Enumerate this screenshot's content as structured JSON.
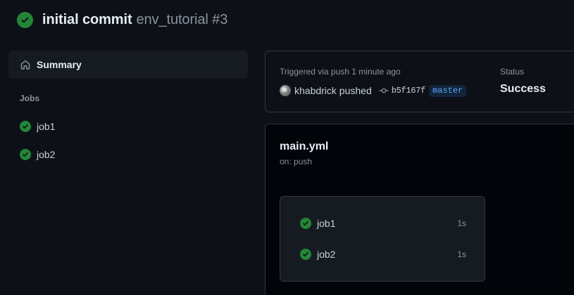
{
  "header": {
    "title": "initial commit",
    "subtitle": "env_tutorial #3",
    "status_icon": "check-circle-icon"
  },
  "sidebar": {
    "summary_label": "Summary",
    "jobs_heading": "Jobs",
    "jobs": [
      {
        "label": "job1"
      },
      {
        "label": "job2"
      }
    ]
  },
  "run": {
    "trigger_text": "Triggered via push 1 minute ago",
    "actor_text": "khabdrick pushed",
    "commit_sha": "b5f167f",
    "branch": "master",
    "status_label": "Status",
    "status_value": "Success"
  },
  "workflow": {
    "file": "main.yml",
    "trigger": "on: push",
    "jobs": [
      {
        "label": "job1",
        "duration": "1s"
      },
      {
        "label": "job2",
        "duration": "1s"
      }
    ]
  },
  "colors": {
    "background": "#0d1117",
    "success": "#238636",
    "link": "#58a6ff"
  }
}
